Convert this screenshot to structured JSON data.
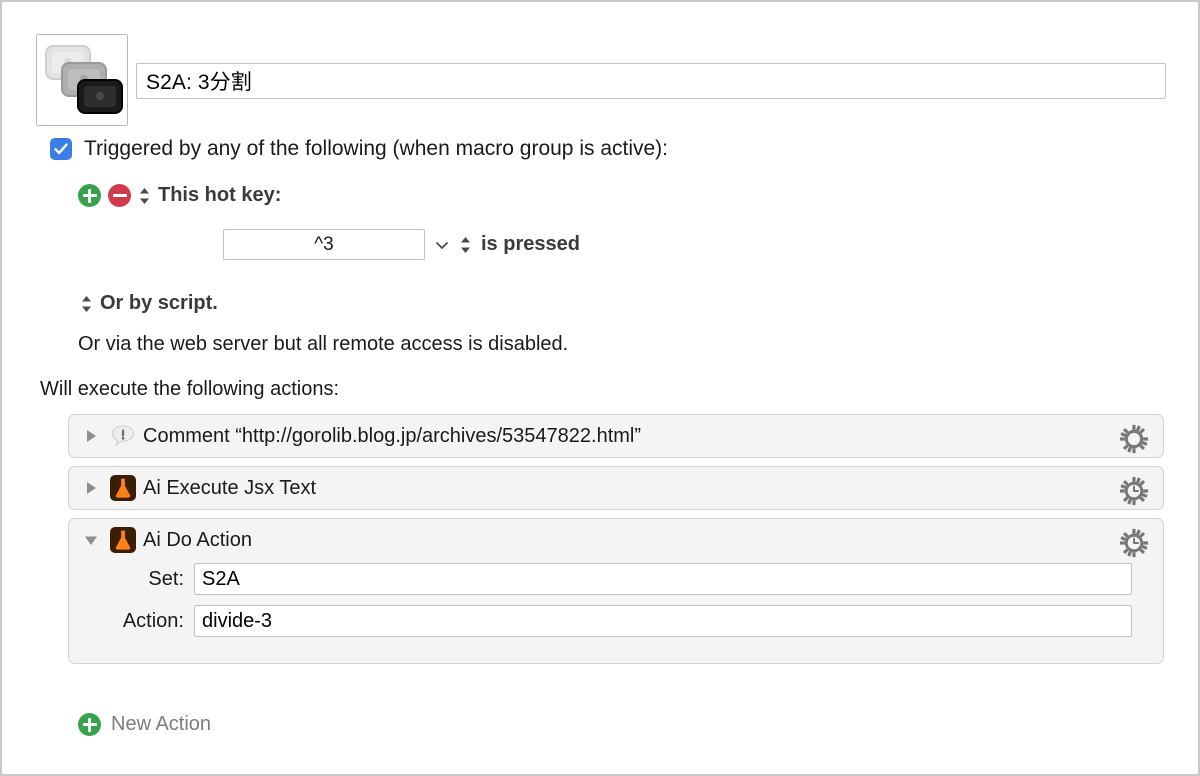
{
  "window": {
    "macro_icon_name": "stacked-screens-icon"
  },
  "header": {
    "title_value": "S2A: 3分割",
    "title_placeholder": "Macro Name"
  },
  "trigger": {
    "checkbox_checked": true,
    "label": "Triggered by any of the following (when macro group is active):",
    "add_button_label": "+",
    "remove_button_label": "−",
    "hot_key_label": "This hot key:",
    "hot_key_value": "^3",
    "hot_key_condition": "is pressed",
    "script_label": "Or by script.",
    "webserver_label": "Or via the web server but all remote access is disabled."
  },
  "actions": {
    "heading": "Will execute the following actions:",
    "items": [
      {
        "title": "Comment “http://gorolib.blog.jp/archives/53547822.html”",
        "icon": "comment-bubble-icon",
        "expanded": false,
        "disclosure": "collapsed",
        "gear": "gear-icon"
      },
      {
        "title": "Ai Execute Jsx Text",
        "icon": "illustrator-flask-icon",
        "expanded": false,
        "disclosure": "collapsed",
        "gear": "gear-clock-icon"
      },
      {
        "title": "Ai Do Action",
        "icon": "illustrator-flask-icon",
        "expanded": true,
        "disclosure": "expanded",
        "gear": "gear-clock-icon",
        "fields": [
          {
            "label": "Set:",
            "value": "S2A"
          },
          {
            "label": "Action:",
            "value": "divide-3"
          }
        ]
      }
    ],
    "new_action_label": "New Action"
  },
  "colors": {
    "accent_blue": "#3b7ee8",
    "add_green": "#36a24a",
    "remove_red": "#cf3b4b",
    "illustrator_orange": "#ff7f18",
    "illustrator_dark": "#3a1f04",
    "row_bg": "#f4f4f4",
    "row_border": "#d2d2d2"
  }
}
